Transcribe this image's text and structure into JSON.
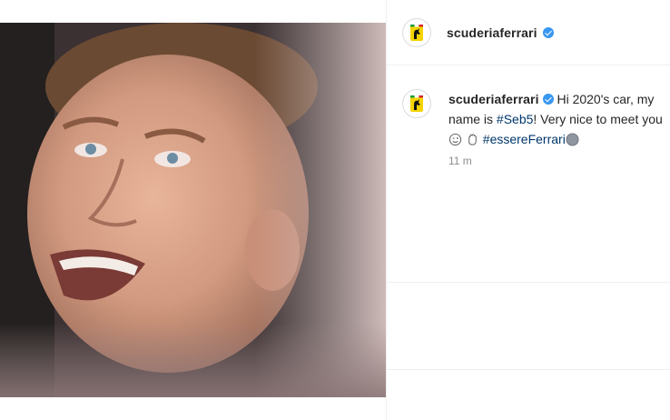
{
  "post": {
    "photo_description_icon": "portrait-photo"
  },
  "header": {
    "username": "scuderiaferrari",
    "avatar_icon": "ferrari-logo-icon",
    "verified_icon": "verified-badge-icon"
  },
  "caption": {
    "username": "scuderiaferrari",
    "text_part1": " Hi 2020's car, my name is ",
    "hashtag1": "#Seb5",
    "text_part2": "! Very nice to meet you ",
    "emoji1": "wink-emoji-icon",
    "emoji2": "waving-hand-emoji-icon",
    "hashtag2": "#essereFerrari",
    "emoji3": "grey-circle-emoji-icon",
    "timestamp": "11 m"
  },
  "colors": {
    "verified": "#3897f0",
    "hashtag": "#00376b",
    "ferrari_yellow": "#f5d300",
    "muted": "#8e8e8e"
  }
}
